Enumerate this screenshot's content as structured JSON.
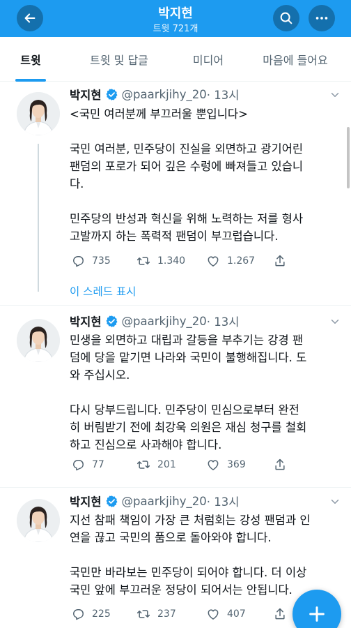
{
  "header": {
    "title": "박지현",
    "subtitle": "트윗 721개",
    "accent_color": "#1d9bf0",
    "back_icon": "arrow-left-icon",
    "search_icon": "search-icon",
    "more_icon": "more-horizontal-icon"
  },
  "tabs": [
    {
      "label": "트윗",
      "active": true
    },
    {
      "label": "트윗 및 답글",
      "active": false
    },
    {
      "label": "미디어",
      "active": false
    },
    {
      "label": "마음에 들어요",
      "active": false
    }
  ],
  "tweets": [
    {
      "name": "박지현",
      "handle": "@paarkjihy_20",
      "time": "· 13시",
      "paragraphs": [
        [
          "<국민 여러분께 부끄러울 뿐입니다>"
        ],
        [
          "국민 여러분, 민주당이 진실을 외면하고 광기어린",
          "팬덤의 포로가 되어 깊은 수렁에 빠져들고 있습니",
          "다."
        ],
        [
          "민주당의 반성과 혁신을 위해 노력하는 저를 형사",
          "고발까지 하는 폭력적 팬덤이 부끄럽습니다."
        ]
      ],
      "replies": "735",
      "retweets": "1.340",
      "likes": "1.267"
    },
    {
      "name": "박지현",
      "handle": "@paarkjihy_20",
      "time": "· 13시",
      "paragraphs": [
        [
          "민생을 외면하고 대립과 갈등을 부추기는 강경 팬",
          "덤에 당을 맡기면 나라와 국민이 불행해집니다. 도",
          "와 주십시오."
        ],
        [
          "다시 당부드립니다. 민주당이 민심으로부터 완전",
          "히 버림받기 전에 최강욱 의원은 재심 청구를 철회",
          "하고 진심으로 사과해야 합니다."
        ]
      ],
      "replies": "77",
      "retweets": "201",
      "likes": "369"
    },
    {
      "name": "박지현",
      "handle": "@paarkjihy_20",
      "time": "· 13시",
      "paragraphs": [
        [
          "지선 참패 책임이 가장 큰 처럼회는 강성 팬덤과 인",
          "연을 끊고 국민의 품으로 돌아와야 합니다."
        ],
        [
          "국민만 바라보는 민주당이 되어야 합니다. 더 이상",
          "국민 앞에 부끄러운 정당이 되어서는 안됩니다."
        ]
      ],
      "replies": "225",
      "retweets": "237",
      "likes": "407"
    }
  ],
  "show_thread_label": "이 스레드 표시",
  "compose_icon": "plus-icon"
}
